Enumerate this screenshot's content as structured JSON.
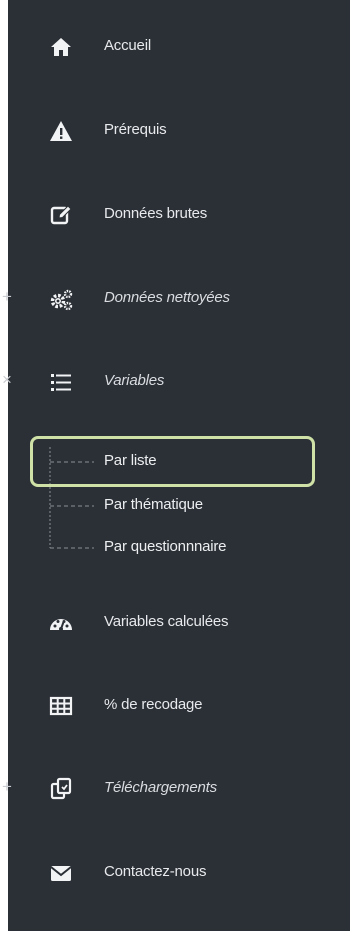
{
  "sidebar": {
    "items": [
      {
        "label": "Accueil",
        "icon": "home-icon"
      },
      {
        "label": "Prérequis",
        "icon": "warning-icon"
      },
      {
        "label": "Données brutes",
        "icon": "edit-icon"
      },
      {
        "label": "Données nettoyées",
        "icon": "gears-icon",
        "toggle": "+"
      },
      {
        "label": "Variables",
        "icon": "list-icon",
        "toggle": "×",
        "children": [
          {
            "label": "Par liste",
            "selected": true
          },
          {
            "label": "Par thématique"
          },
          {
            "label": "Par questionnnaire"
          }
        ]
      },
      {
        "label": "Variables calculées",
        "icon": "dashboard-icon"
      },
      {
        "label": "% de recodage",
        "icon": "table-icon"
      },
      {
        "label": "Téléchargements",
        "icon": "clone-icon",
        "toggle": "+"
      },
      {
        "label": "Contactez-nous",
        "icon": "envelope-icon"
      }
    ]
  },
  "colors": {
    "sidebar_bg": "#2b3036",
    "text": "#e7e9ec",
    "highlight_border": "#cfe1a6"
  }
}
